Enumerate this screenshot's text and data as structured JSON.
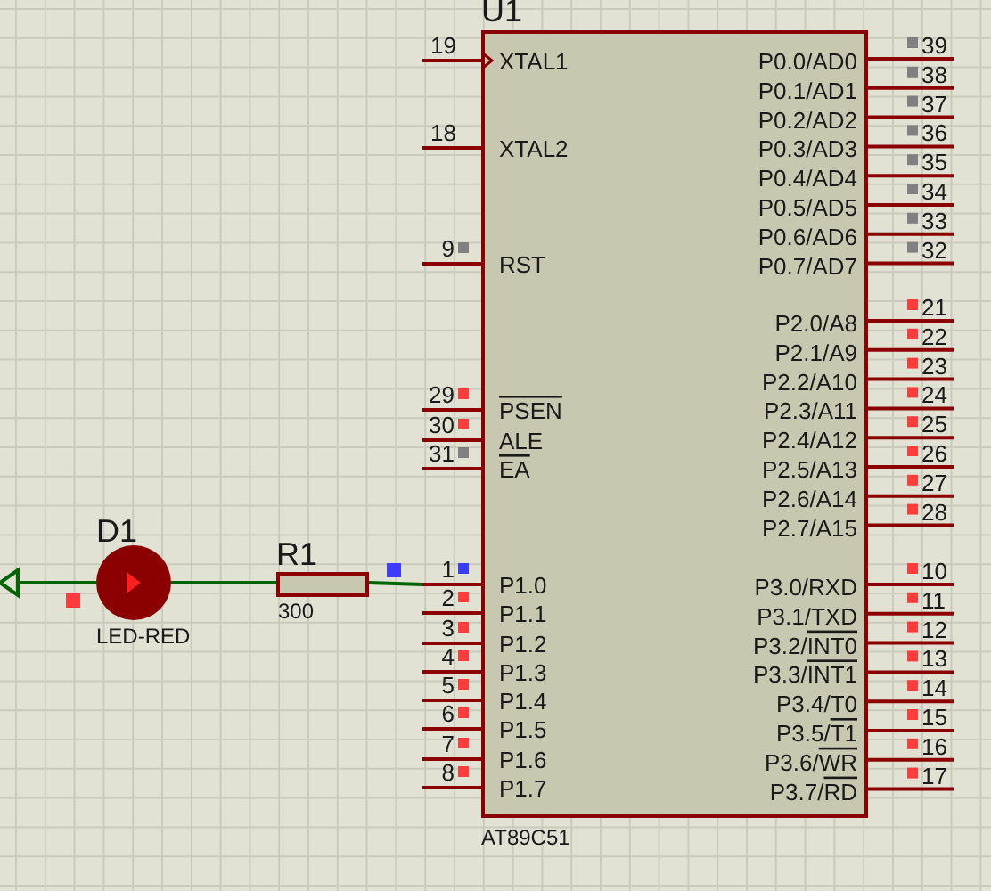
{
  "component": {
    "reference": "U1",
    "part": "AT89C51",
    "left_pins": [
      {
        "number": "19",
        "label": "XTAL1",
        "clock": true
      },
      {
        "number": "18",
        "label": "XTAL2"
      },
      {
        "number": "9",
        "label": "RST",
        "color": "#808080"
      },
      {
        "number": "29",
        "bar": "PSEN",
        "color": "#ff3c3c"
      },
      {
        "number": "30",
        "label": "ALE",
        "color": "#ff3c3c"
      },
      {
        "number": "31",
        "bar": "EA",
        "color": "#808080"
      },
      {
        "number": "1",
        "label": "P1.0",
        "color": "#3c3cff"
      },
      {
        "number": "2",
        "label": "P1.1",
        "color": "#ff3c3c"
      },
      {
        "number": "3",
        "label": "P1.2",
        "color": "#ff3c3c"
      },
      {
        "number": "4",
        "label": "P1.3",
        "color": "#ff3c3c"
      },
      {
        "number": "5",
        "label": "P1.4",
        "color": "#ff3c3c"
      },
      {
        "number": "6",
        "label": "P1.5",
        "color": "#ff3c3c"
      },
      {
        "number": "7",
        "label": "P1.6",
        "color": "#ff3c3c"
      },
      {
        "number": "8",
        "label": "P1.7",
        "color": "#ff3c3c"
      }
    ],
    "right_pins": [
      {
        "number": "39",
        "label": "P0.0/AD0",
        "color": "#808080"
      },
      {
        "number": "38",
        "label": "P0.1/AD1",
        "color": "#808080"
      },
      {
        "number": "37",
        "label": "P0.2/AD2",
        "color": "#808080"
      },
      {
        "number": "36",
        "label": "P0.3/AD3",
        "color": "#808080"
      },
      {
        "number": "35",
        "label": "P0.4/AD4",
        "color": "#808080"
      },
      {
        "number": "34",
        "label": "P0.5/AD5",
        "color": "#808080"
      },
      {
        "number": "33",
        "label": "P0.6/AD6",
        "color": "#808080"
      },
      {
        "number": "32",
        "label": "P0.7/AD7",
        "color": "#808080"
      },
      {
        "number": "21",
        "label": "P2.0/A8",
        "color": "#ff3c3c"
      },
      {
        "number": "22",
        "label": "P2.1/A9",
        "color": "#ff3c3c"
      },
      {
        "number": "23",
        "label": "P2.2/A10",
        "color": "#ff3c3c"
      },
      {
        "number": "24",
        "label": "P2.3/A11",
        "color": "#ff3c3c"
      },
      {
        "number": "25",
        "label": "P2.4/A12",
        "color": "#ff3c3c"
      },
      {
        "number": "26",
        "label": "P2.5/A13",
        "color": "#ff3c3c"
      },
      {
        "number": "27",
        "label": "P2.6/A14",
        "color": "#ff3c3c"
      },
      {
        "number": "28",
        "label": "P2.7/A15",
        "color": "#ff3c3c"
      },
      {
        "number": "10",
        "label": "P3.0/RXD",
        "color": "#ff3c3c"
      },
      {
        "number": "11",
        "label": "P3.1/TXD",
        "color": "#ff3c3c"
      },
      {
        "number": "12",
        "label": "P3.2/",
        "bar": "INT0",
        "color": "#ff3c3c"
      },
      {
        "number": "13",
        "label": "P3.3/",
        "bar": "INT1",
        "color": "#ff3c3c"
      },
      {
        "number": "14",
        "label": "P3.4/T0",
        "color": "#ff3c3c"
      },
      {
        "number": "15",
        "label": "P3.5/",
        "bar": "T1",
        "color": "#ff3c3c"
      },
      {
        "number": "16",
        "label": "P3.6/",
        "bar": "WR",
        "color": "#ff3c3c"
      },
      {
        "number": "17",
        "label": "P3.7/",
        "bar": "RD",
        "color": "#ff3c3c"
      }
    ]
  },
  "led": {
    "reference": "D1",
    "value": "LED-RED",
    "color": "#ff3c3c"
  },
  "resistor": {
    "reference": "R1",
    "value": "300",
    "color": "#3c3cff"
  }
}
